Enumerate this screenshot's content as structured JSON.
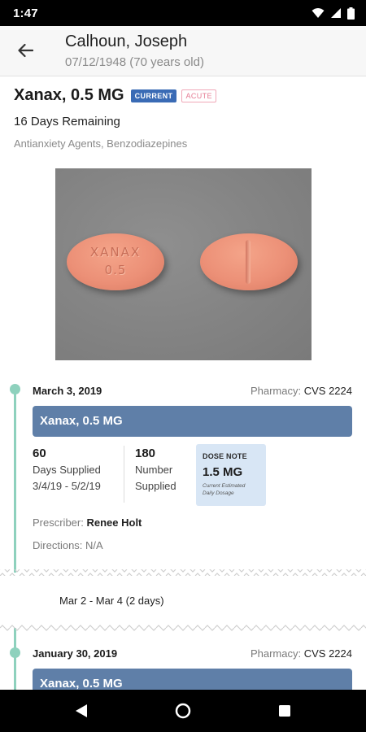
{
  "status_bar": {
    "time": "1:47"
  },
  "header": {
    "patient_name": "Calhoun, Joseph",
    "patient_dob": "07/12/1948 (70 years old)"
  },
  "medication": {
    "name": "Xanax, 0.5 MG",
    "badge_current": "CURRENT",
    "badge_acute": "ACUTE",
    "days_remaining": "16 Days Remaining",
    "drug_class": "Antianxiety Agents, Benzodiazepines",
    "pill_imprint_line1": "XANAX",
    "pill_imprint_line2": "0.5"
  },
  "entries": [
    {
      "date": "March 3, 2019",
      "pharmacy_label": "Pharmacy:",
      "pharmacy_name": "CVS 2224",
      "banner": "Xanax, 0.5 MG",
      "days_supplied_value": "60",
      "days_supplied_label1": "Days Supplied",
      "days_supplied_label2": "3/4/19 - 5/2/19",
      "number_supplied_value": "180",
      "number_supplied_label1": "Number",
      "number_supplied_label2": "Supplied",
      "dose_note_label": "DOSE NOTE",
      "dose_note_value": "1.5 MG",
      "dose_note_sub1": "Current Estimated",
      "dose_note_sub2": "Daily Dosage",
      "prescriber_label": "Prescriber:",
      "prescriber_name": "Renee Holt",
      "directions_label": "Directions:",
      "directions_value": "N/A"
    },
    {
      "date": "January 30, 2019",
      "pharmacy_label": "Pharmacy:",
      "pharmacy_name": "CVS 2224",
      "banner": "Xanax, 0.5 MG"
    }
  ],
  "gap": {
    "text": "Mar 2 - Mar 4 (2 days)"
  },
  "colors": {
    "accent_timeline": "#8ed1bd",
    "banner_blue": "#5f7fa8",
    "badge_blue": "#3a6bb5",
    "dose_note_bg": "#d8e6f5"
  },
  "icons": [
    "signal-icon",
    "wifi-icon",
    "battery-icon",
    "back-arrow-icon",
    "nav-back-icon",
    "nav-home-icon",
    "nav-recents-icon"
  ]
}
